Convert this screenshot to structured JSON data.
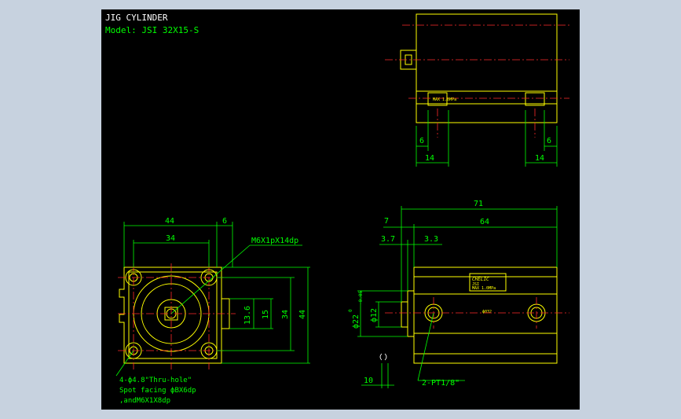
{
  "title": {
    "heading": "JIG CYLINDER",
    "model": "Model: JSI 32X15-S"
  },
  "label_plate": {
    "brand": "CHELIC",
    "small_text_1": "JSI",
    "small_text_2": "MAX 1.0MPa",
    "port_text": "ф032"
  },
  "top_view": {
    "dim_left_6": "6",
    "dim_right_6": "6",
    "dim_left_14": "14",
    "dim_right_14": "14"
  },
  "front_view": {
    "dim_44_top": "44",
    "dim_6_top": "6",
    "dim_34_top": "34",
    "dim_13_6": "13.6",
    "dim_15": "15",
    "dim_34_right": "34",
    "dim_44_right": "44",
    "note_thread": "M6X1pX14dp",
    "note_holes_1": "4-ф4.8\"Thru-hole\"",
    "note_holes_2": "Spot facing фBX6dp",
    "note_holes_3": ",andM6X1X8dp"
  },
  "side_view": {
    "dim_71": "71",
    "dim_7": "7",
    "dim_64": "64",
    "dim_3_7": "3.7",
    "dim_3_3": "3.3",
    "dim_d22": "ф22",
    "dim_d22_tol_upper": "0",
    "dim_d22_tol_lower": "-0.05",
    "dim_d12": "ф12",
    "dim_10": "10",
    "note_port": "2-PT1/8\""
  },
  "colors": {
    "background": "#000000",
    "outer_background": "#c7d2df",
    "outline": "#ffff00",
    "dimension": "#00ff00",
    "centerline": "#ff2a2a",
    "text": "#ffffff"
  }
}
